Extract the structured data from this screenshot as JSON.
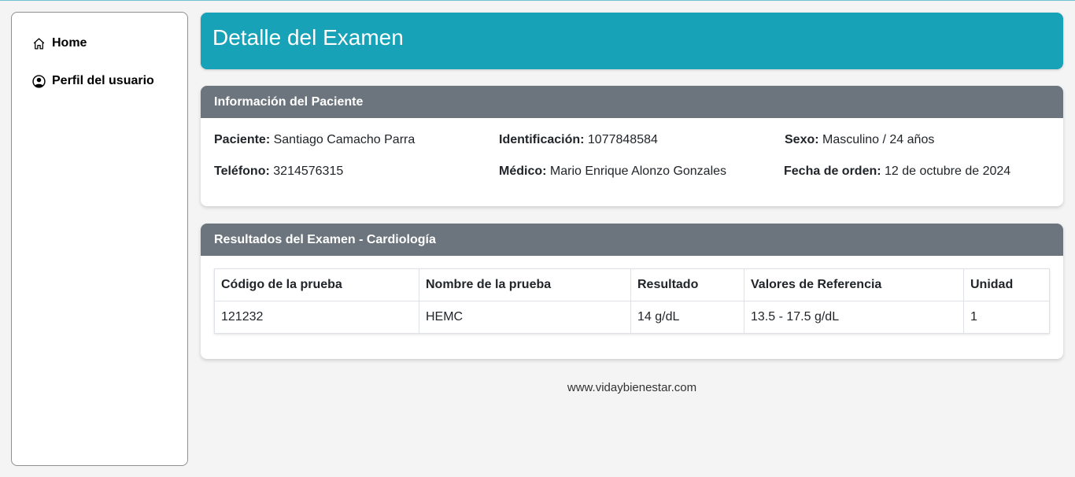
{
  "sidebar": {
    "items": [
      {
        "label": "Home",
        "icon": "home-icon"
      },
      {
        "label": "Perfil del usuario",
        "icon": "user-circle-icon"
      }
    ]
  },
  "header": {
    "title": "Detalle del Examen"
  },
  "patient_info": {
    "title": "Información del Paciente",
    "fields": {
      "patient": {
        "label": "Paciente:",
        "value": "Santiago Camacho Parra"
      },
      "id": {
        "label": "Identificación:",
        "value": "1077848584"
      },
      "sex": {
        "label": "Sexo:",
        "value": "Masculino / 24 años"
      },
      "phone": {
        "label": "Teléfono:",
        "value": "3214576315"
      },
      "doctor": {
        "label": "Médico:",
        "value": "Mario Enrique Alonzo Gonzales"
      },
      "order_date": {
        "label": "Fecha de orden:",
        "value": "12 de octubre de 2024"
      }
    }
  },
  "results": {
    "title": "Resultados del Examen - Cardiología",
    "columns": [
      "Código de la prueba",
      "Nombre de la prueba",
      "Resultado",
      "Valores de Referencia",
      "Unidad"
    ],
    "rows": [
      [
        "121232",
        "HEMC",
        "14 g/dL",
        "13.5 - 17.5 g/dL",
        "1"
      ]
    ]
  },
  "footer": {
    "text": "www.vidaybienestar.com"
  },
  "colors": {
    "header": "#17a2b8",
    "card_header": "#6c757d",
    "background": "#f4f4f4"
  }
}
